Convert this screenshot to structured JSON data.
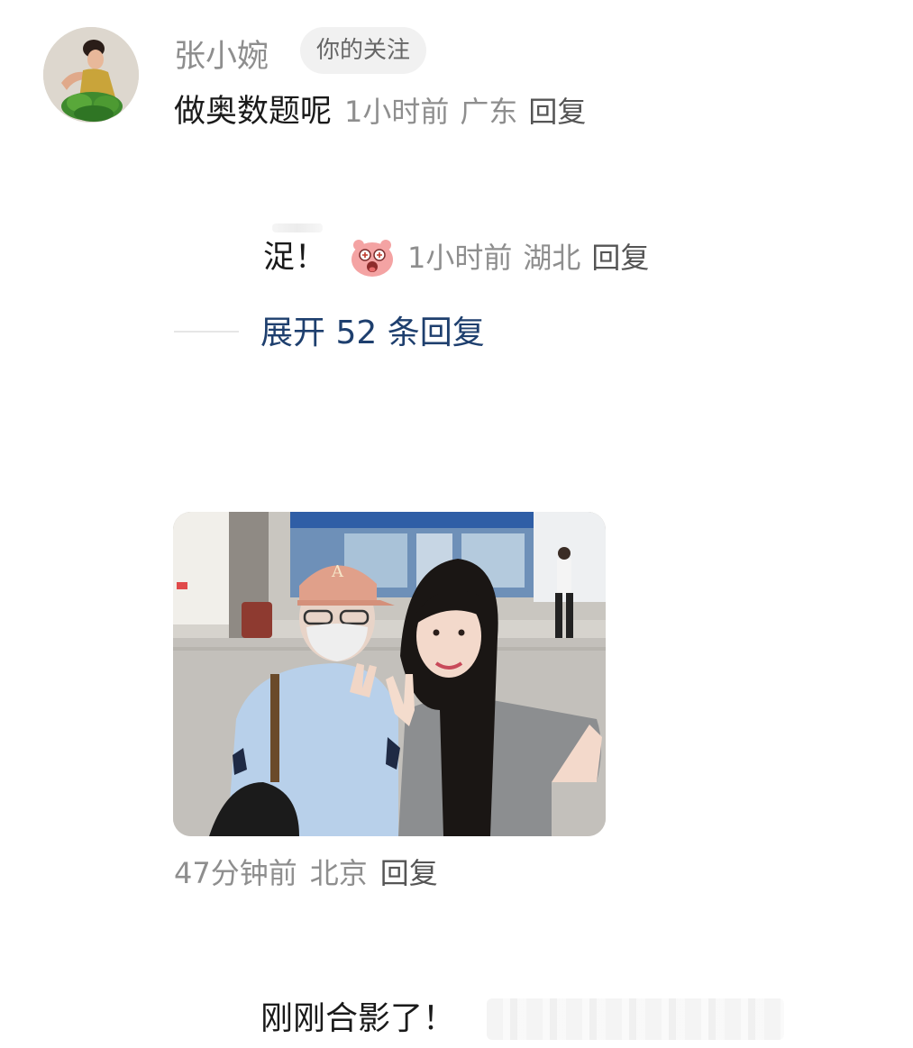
{
  "comment": {
    "username": "张小婉",
    "follow_badge": "你的关注",
    "text": "做奥数题呢",
    "time": "1小时前",
    "location": "广东",
    "reply": "回复"
  },
  "sub_reply": {
    "text": "浞！",
    "emoji": "surprised-face-emoji",
    "time": "1小时前",
    "location": "湖北",
    "reply": "回复"
  },
  "expand": {
    "label": "展开 52 条回复"
  },
  "photo_comment": {
    "time": "47分钟前",
    "location": "北京",
    "reply": "回复"
  },
  "bottom_comment": {
    "text": "刚刚合影了！"
  },
  "colors": {
    "meta_gray": "#8e8e8e",
    "expand_link": "#1e3f6e",
    "badge_bg": "#f1f1f1"
  }
}
